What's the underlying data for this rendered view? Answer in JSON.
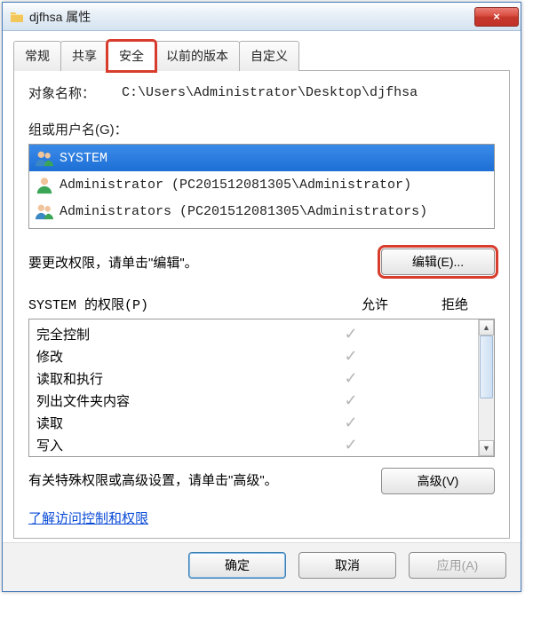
{
  "window": {
    "title": "djfhsa 属性",
    "close_glyph": "×"
  },
  "tabs": {
    "general": "常规",
    "sharing": "共享",
    "security": "安全",
    "previous": "以前的版本",
    "custom": "自定义",
    "active": "security"
  },
  "object": {
    "label": "对象名称：",
    "path": "C:\\Users\\Administrator\\Desktop\\djfhsa"
  },
  "groups": {
    "label": "组或用户名(G)：",
    "items": [
      {
        "name": "SYSTEM",
        "icon": "group",
        "selected": true
      },
      {
        "name": "Administrator (PC201512081305\\Administrator)",
        "icon": "user",
        "selected": false
      },
      {
        "name": "Administrators (PC201512081305\\Administrators)",
        "icon": "group",
        "selected": false
      }
    ]
  },
  "edit": {
    "hint": "要更改权限，请单击\"编辑\"。",
    "button": "编辑(E)..."
  },
  "permissions": {
    "header_label": "SYSTEM 的权限(P)",
    "allow": "允许",
    "deny": "拒绝",
    "rows": [
      {
        "name": "完全控制",
        "allow": true,
        "deny": false
      },
      {
        "name": "修改",
        "allow": true,
        "deny": false
      },
      {
        "name": "读取和执行",
        "allow": true,
        "deny": false
      },
      {
        "name": "列出文件夹内容",
        "allow": true,
        "deny": false
      },
      {
        "name": "读取",
        "allow": true,
        "deny": false
      },
      {
        "name": "写入",
        "allow": true,
        "deny": false
      }
    ]
  },
  "advanced": {
    "hint": "有关特殊权限或高级设置，请单击\"高级\"。",
    "button": "高级(V)"
  },
  "link": {
    "text": "了解访问控制和权限"
  },
  "dialog_buttons": {
    "ok": "确定",
    "cancel": "取消",
    "apply": "应用(A)"
  },
  "scroll": {
    "up": "▲",
    "down": "▼"
  }
}
